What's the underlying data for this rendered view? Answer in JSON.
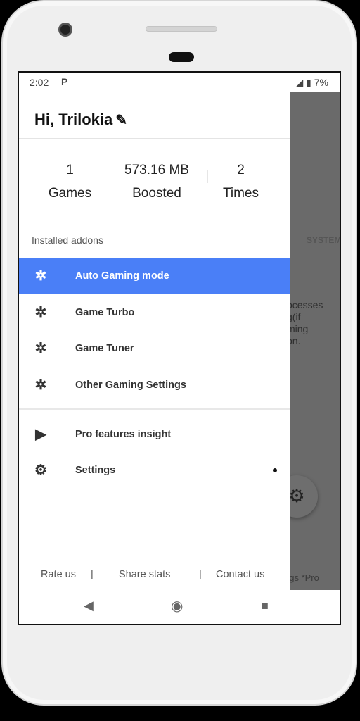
{
  "status": {
    "time": "2:02",
    "notification": "P",
    "battery": "7%"
  },
  "drawer": {
    "greeting": "Hi, Trilokia",
    "stats": [
      {
        "value": "1",
        "label": "Games"
      },
      {
        "value": "573.16 MB",
        "label": "Boosted"
      },
      {
        "value": "2",
        "label": "Times"
      }
    ],
    "section_title": "Installed addons",
    "addons": [
      {
        "label": "Auto Gaming mode",
        "icon": "puzzle-icon",
        "active": true
      },
      {
        "label": "Game Turbo",
        "icon": "puzzle-icon"
      },
      {
        "label": "Game Tuner",
        "icon": "puzzle-icon"
      },
      {
        "label": "Other Gaming Settings",
        "icon": "puzzle-icon"
      }
    ],
    "other": [
      {
        "label": "Pro features insight",
        "icon": "play-bag-icon"
      },
      {
        "label": "Settings",
        "icon": "gear-icon"
      }
    ],
    "footer": {
      "rate": "Rate us",
      "sep": "|",
      "share": "Share stats",
      "contact": "Contact us"
    }
  },
  "background": {
    "tab": "SYSTEM",
    "desc": "ocesses\ng(if\nming\non.",
    "footer": "ngs *Pro"
  },
  "colors": {
    "accent": "#4a7ff7"
  }
}
